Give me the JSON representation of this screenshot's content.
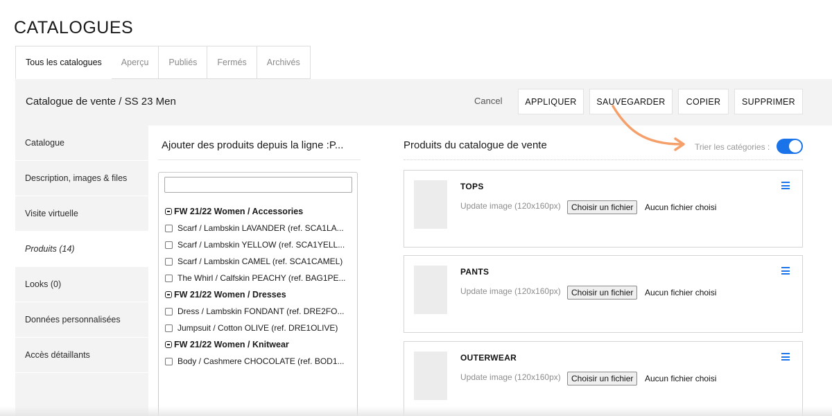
{
  "page": {
    "title": "CATALOGUES"
  },
  "tabs": [
    {
      "label": "Tous les catalogues",
      "active": true
    },
    {
      "label": "Aperçu"
    },
    {
      "label": "Publiés"
    },
    {
      "label": "Fermés"
    },
    {
      "label": "Archivés"
    }
  ],
  "header": {
    "title": "Catalogue de vente / SS 23 Men",
    "cancel": "Cancel",
    "apply": "APPLIQUER",
    "save": "SAUVEGARDER",
    "copy": "COPIER",
    "delete": "SUPPRIMER"
  },
  "sidebar": {
    "items": [
      {
        "label": "Catalogue"
      },
      {
        "label": "Description, images & files"
      },
      {
        "label": "Visite virtuelle"
      },
      {
        "label": "Produits (14)",
        "active": true
      },
      {
        "label": "Looks (0)"
      },
      {
        "label": "Données personnalisées"
      },
      {
        "label": "Accès détaillants"
      }
    ]
  },
  "source": {
    "title": "Ajouter des produits depuis la ligne :P...",
    "search_value": "",
    "groups": [
      {
        "label": "FW 21/22 Women / Accessories",
        "items": [
          "Scarf / Lambskin LAVANDER (ref. SCA1LA...",
          "Scarf / Lambskin YELLOW (ref. SCA1YELL...",
          "Scarf / Lambskin CAMEL (ref. SCA1CAMEL)",
          "The Whirl / Calfskin PEACHY (ref. BAG1PE..."
        ]
      },
      {
        "label": "FW 21/22 Women / Dresses",
        "items": [
          "Dress / Lambskin FONDANT (ref. DRE2FO...",
          "Jumpsuit / Cotton OLIVE (ref. DRE1OLIVE)"
        ]
      },
      {
        "label": "FW 21/22 Women / Knitwear",
        "items": [
          "Body / Cashmere CHOCOLATE (ref. BOD1..."
        ]
      }
    ]
  },
  "catalog": {
    "title": "Produits du catalogue de vente",
    "sort_label": "Trier les catégories :",
    "sort_enabled": true,
    "accent_color": "#1a73e8",
    "categories": [
      {
        "name": "TOPS",
        "upload_label": "Update image (120x160px)",
        "file_button": "Choisir un fichier",
        "file_status": "Aucun fichier choisi"
      },
      {
        "name": "PANTS",
        "upload_label": "Update image (120x160px)",
        "file_button": "Choisir un fichier",
        "file_status": "Aucun fichier choisi"
      },
      {
        "name": "OUTERWEAR",
        "upload_label": "Update image (120x160px)",
        "file_button": "Choisir un fichier",
        "file_status": "Aucun fichier choisi"
      }
    ]
  },
  "annotation": {
    "arrow_color": "#f5a06a"
  }
}
